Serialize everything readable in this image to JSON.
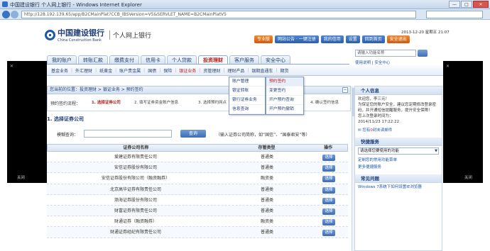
{
  "window": {
    "title": "中国建设银行 个人网上银行 - Windows Internet Explorer",
    "min": "—",
    "max": "□",
    "close": "✕"
  },
  "address": {
    "url": "http://128.192.139.65/app/B2CMainPlat?CCB_IBSVersion=V5&SERVLET_NAME=B2CMainPlatV5",
    "nav_back": "◀",
    "nav_fwd": "▶"
  },
  "brand": {
    "name_cn": "中国建设银行",
    "name_en": "China Construction Bank",
    "product": "个人网上银行"
  },
  "header": {
    "datetime": "2013-12-20 星期五 21:07",
    "buttons": [
      {
        "label": "专业版"
      },
      {
        "label": "网站公告 · 一键注册"
      },
      {
        "label": "我的信用"
      },
      {
        "label": "设置"
      },
      {
        "label": "回到首页"
      },
      {
        "label": "安全退出"
      }
    ],
    "search_placeholder": "请输入功能名称",
    "help_link": "使用说明 | 安全中心"
  },
  "main_tabs": [
    {
      "label": "我的账户",
      "active": false
    },
    {
      "label": "转账汇款",
      "active": false
    },
    {
      "label": "缴费支付",
      "active": false
    },
    {
      "label": "信用卡",
      "active": false
    },
    {
      "label": "个人贷款",
      "active": false
    },
    {
      "label": "投资理财",
      "active": true
    },
    {
      "label": "客户服务",
      "active": false
    },
    {
      "label": "安全中心",
      "active": false
    }
  ],
  "sub_nav": [
    {
      "label": "基金业务",
      "hot": false
    },
    {
      "label": "外汇理财",
      "hot": false
    },
    {
      "label": "纸黄金",
      "hot": false
    },
    {
      "label": "账户贵金属",
      "hot": false
    },
    {
      "label": "国债",
      "hot": false
    },
    {
      "label": "保险",
      "hot": false
    },
    {
      "label": "银证业务",
      "hot": true
    },
    {
      "label": "资管理财",
      "hot": false
    },
    {
      "label": "理财产品",
      "hot": false
    },
    {
      "label": "银期直通车",
      "hot": false
    },
    {
      "label": "期货",
      "hot": false
    }
  ],
  "dropdown": {
    "col1": [
      "账户管理",
      "银证转账",
      "银行证券业务",
      "信息查询"
    ],
    "col2": [
      "预约签约",
      "变更签约",
      "开户预约查询",
      "开户预约撤销"
    ],
    "selected_col2": 0
  },
  "black_panels": {
    "left_close": "关闭",
    "right_close": "关闭",
    "x": "✕"
  },
  "breadcrumb": {
    "text": "您当前的位置：投资理财 > 银证业务 > 预约签约",
    "collapse": "−"
  },
  "steps": {
    "label": "预约签约流程：",
    "items": [
      {
        "label": "1. 选择证券公司",
        "current": true
      },
      {
        "label": "2. 填写证券资金账户信息",
        "current": false
      },
      {
        "label": "3. 选择预约网点",
        "current": false
      },
      {
        "label": "4. 确认签约信息",
        "current": false
      }
    ]
  },
  "section": {
    "title": "1. 选择证券公司",
    "filter_label": "模糊查询：",
    "filter_value": "",
    "filter_button": "查询",
    "filter_hint": "（输入证券公司简称，如“国信”、“国泰君安”等）"
  },
  "table": {
    "headers": [
      "证券公司名称",
      "存管类型",
      "操作"
    ],
    "rows": [
      {
        "name": "爱建证券有限责任公司",
        "type": "普通类",
        "op": "选择"
      },
      {
        "name": "安信证券股份有限公司",
        "type": "普通类",
        "op": "选择"
      },
      {
        "name": "安信证券股份有限公司（融资融券）",
        "type": "融资类",
        "op": "选择"
      },
      {
        "name": "北京高华证券有限责任公司",
        "type": "普通类",
        "op": "选择"
      },
      {
        "name": "渤海证券股份有限公司",
        "type": "普通类",
        "op": "选择"
      },
      {
        "name": "财富证券有限责任公司",
        "type": "普通类",
        "op": "选择"
      },
      {
        "name": "财通证券（融资融券）",
        "type": "融资类",
        "op": "选择"
      },
      {
        "name": "财通证券经纪有限责任公司",
        "type": "普通类",
        "op": "选择"
      }
    ]
  },
  "right_panel": {
    "personal_title": "个人信息",
    "greeting": "欢迎您，李三元！",
    "message": "为保证您的账户安全，建议您定期修改登录密码，并开通短信提醒服务，提升安全保障！",
    "last_login": "您上次登录时间为：",
    "last_login_time": "2014/11/23 17:22:22",
    "unread_prefix": "您有",
    "unread_count": "0",
    "unread_suffix": "封未读邮件",
    "quick_title": "快捷服务",
    "quick_select": "请选择您要使用的功能",
    "quick_links": [
      "定制您的常用功能菜单",
      "更多便捷服务"
    ],
    "faq_title": "常见问题",
    "faq_link": "Windows 7系统下如何设置IE浏览器"
  }
}
